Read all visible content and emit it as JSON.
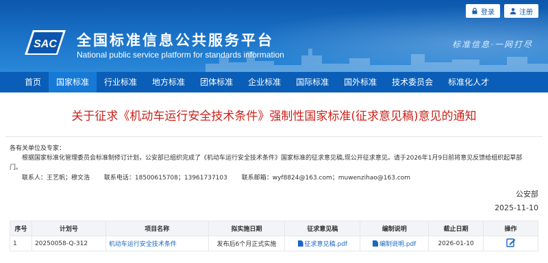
{
  "header": {
    "login_label": "登录",
    "register_label": "注册",
    "logo_text": "SAC",
    "title_cn": "全国标准信息公共服务平台",
    "title_en": "National public service platform  for standards information",
    "slogan": "标准信息·一网打尽",
    "brand_color": "#0a5eb8"
  },
  "nav": {
    "items": [
      "首页",
      "国家标准",
      "行业标准",
      "地方标准",
      "团体标准",
      "企业标准",
      "国际标准",
      "国外标准",
      "技术委员会",
      "标准化人才"
    ],
    "active_index": 1
  },
  "article": {
    "title": "关于征求《机动车运行安全技术条件》强制性国家标准(征求意见稿)意见的通知",
    "greeting": "各有关单位及专家：",
    "paragraph": "根据国家标准化管理委员会标准制修订计划，公安部已组织完成了《机动车运行安全技术条件》国家标准的征求意见稿,现公开征求意见。请于2026年1月9日前将意见反馈给组织起草部门。",
    "contact_person": "联系人：王艺帆；穆文浩",
    "contact_phone": "联系电话：18500615708；13961737103",
    "contact_email": "联系邮箱：wyf8824@163.com；muwenzihao@163.com",
    "issuer": "公安部",
    "date": "2025-11-10"
  },
  "table": {
    "headers": [
      "序号",
      "计划号",
      "项目名称",
      "拟实施日期",
      "征求意见稿",
      "编制说明",
      "截止日期",
      "操作"
    ],
    "rows": [
      {
        "index": "1",
        "plan_no": "20250058-Q-312",
        "name": "机动车运行安全技术条件",
        "impl_date": "发布后6个月正式实施",
        "draft": "征求意见稿.pdf",
        "explain": "编制说明.pdf",
        "deadline": "2026-01-10",
        "action_icon": "edit-feedback-icon"
      }
    ]
  }
}
